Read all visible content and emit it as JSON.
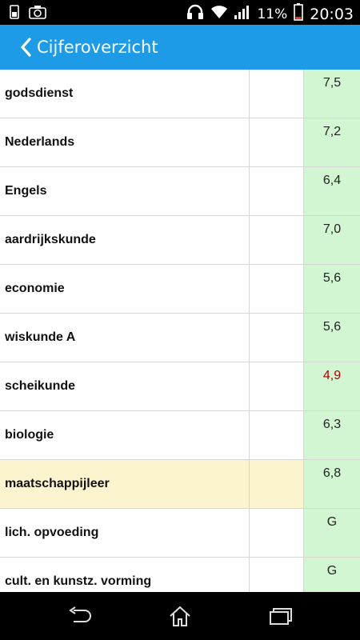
{
  "status_bar": {
    "battery_percent": "11%",
    "time": "20:03",
    "icons": [
      "sim-icon",
      "camera-icon",
      "headphones-icon",
      "wifi-icon",
      "signal-icon",
      "battery-icon"
    ]
  },
  "header": {
    "title": "Cijferoverzicht",
    "back_icon": "chevron-left-icon",
    "background": "#1e9be6"
  },
  "rows": [
    {
      "subject": "godsdienst",
      "grade": "7,5"
    },
    {
      "subject": "Nederlands",
      "grade": "7,2"
    },
    {
      "subject": "Engels",
      "grade": "6,4"
    },
    {
      "subject": "aardrijkskunde",
      "grade": "7,0"
    },
    {
      "subject": "economie",
      "grade": "5,6"
    },
    {
      "subject": "wiskunde A",
      "grade": "5,6"
    },
    {
      "subject": "scheikunde",
      "grade": "4,9"
    },
    {
      "subject": "biologie",
      "grade": "6,3"
    },
    {
      "subject": "maatschappijleer",
      "grade": "6,8"
    },
    {
      "subject": "lich. opvoeding",
      "grade": "G"
    },
    {
      "subject": "cult. en kunstz. vorming",
      "grade": "G"
    }
  ],
  "colors": {
    "grade_cell": "#d2f5d2",
    "highlight_row": "#fcf4cf",
    "failing_grade": "#b00000"
  },
  "nav_bar": {
    "icons": [
      "back-icon",
      "home-icon",
      "recent-apps-icon"
    ]
  }
}
